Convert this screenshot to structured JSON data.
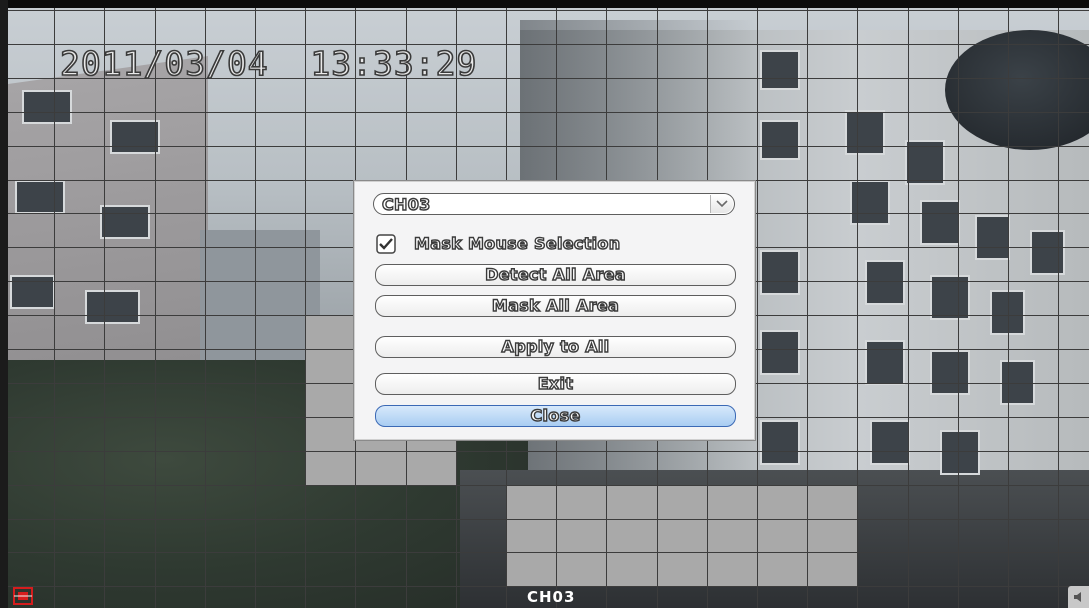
{
  "osd": {
    "timestamp": "2011/03/04  13:33:29",
    "channel": "CH03"
  },
  "dialog": {
    "channel_select": {
      "value": "CH03"
    },
    "mask_mouse_selection": {
      "label": "Mask Mouse Selection",
      "checked": true
    },
    "buttons": {
      "detect_all": "Detect All Area",
      "mask_all": "Mask All Area",
      "apply_all": "Apply to All",
      "exit": "Exit",
      "close": "Close"
    }
  },
  "colors": {
    "grid_line": "#3c3c3c",
    "masked_cell": "#a9a9a9",
    "dialog_bg": "#f4f4f5",
    "close_button": "#a9cdf2",
    "record_indicator": "#d51d1d"
  },
  "icons": {
    "select_arrow": "chevron-down-icon",
    "checkbox": "checkmark-icon",
    "record": "record-icon",
    "speaker": "speaker-icon"
  }
}
